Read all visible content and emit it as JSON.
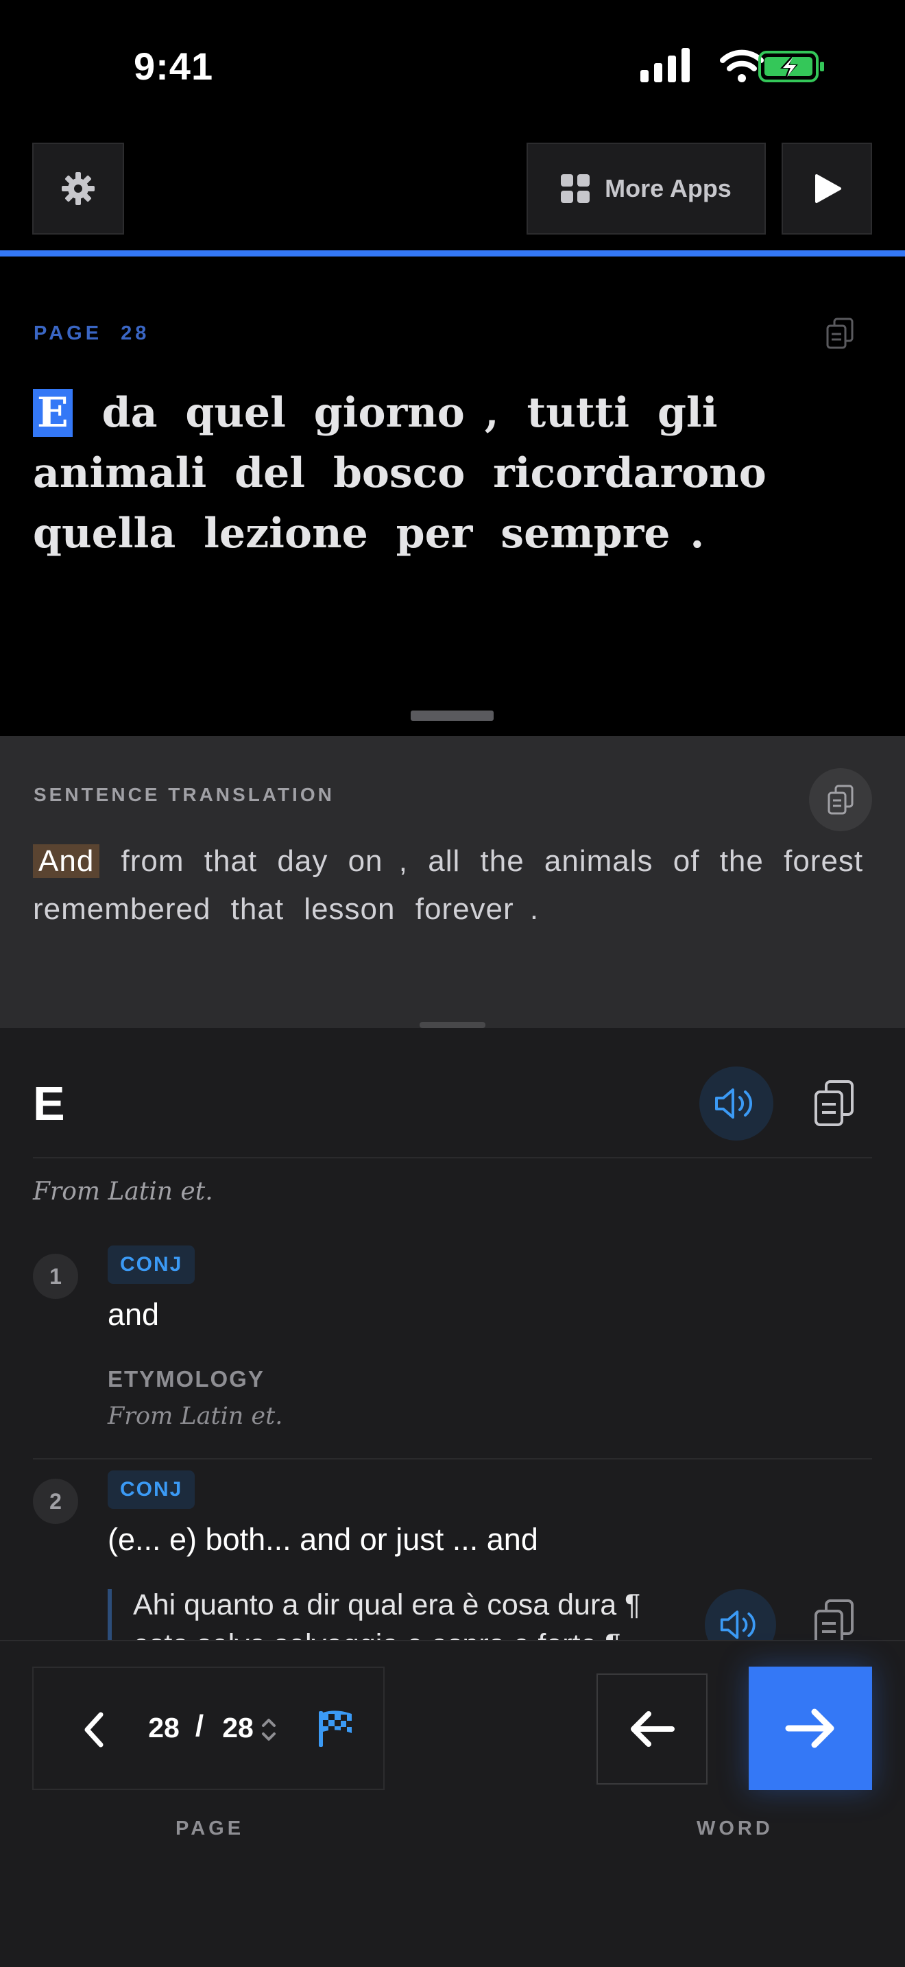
{
  "status_bar": {
    "time": "9:41"
  },
  "toolbar": {
    "more_apps_label": "More Apps"
  },
  "reader": {
    "page_prefix": "PAGE",
    "page_number": "28",
    "sentence": [
      "E",
      "da",
      "quel",
      "giorno",
      ",",
      "tutti",
      "gli",
      "animali",
      "del",
      "bosco",
      "ricordarono",
      "quella",
      "lezione",
      "per",
      "sempre",
      "."
    ],
    "highlight_index": 0
  },
  "translation": {
    "label": "SENTENCE TRANSLATION",
    "tokens": [
      "And",
      "from",
      "that",
      "day",
      "on",
      ",",
      "all",
      "the",
      "animals",
      "of",
      "the",
      "forest",
      "remembered",
      "that",
      "lesson",
      "forever",
      "."
    ],
    "highlight_index": 0
  },
  "dictionary": {
    "word": "E",
    "etymology": "From Latin et.",
    "senses": [
      {
        "number": "1",
        "pos": "CONJ",
        "gloss": "and",
        "etymology_heading": "ETYMOLOGY",
        "etymology": "From Latin et."
      },
      {
        "number": "2",
        "pos": "CONJ",
        "gloss": "(e... e) both... and or just ... and",
        "example_line1": "Ahi quanto a dir qual era è cosa dura ¶",
        "example_line2": "esta selva selvaggia e aspra e forte ¶"
      }
    ]
  },
  "navigation": {
    "current_page": "28",
    "separator": "/",
    "total_pages": "28",
    "page_label": "PAGE",
    "word_label": "WORD"
  },
  "colors": {
    "accent": "#3478f6",
    "highlight_translation": "#5a4431",
    "pos_tag_text": "#3b9af5",
    "battery": "#34c759"
  }
}
